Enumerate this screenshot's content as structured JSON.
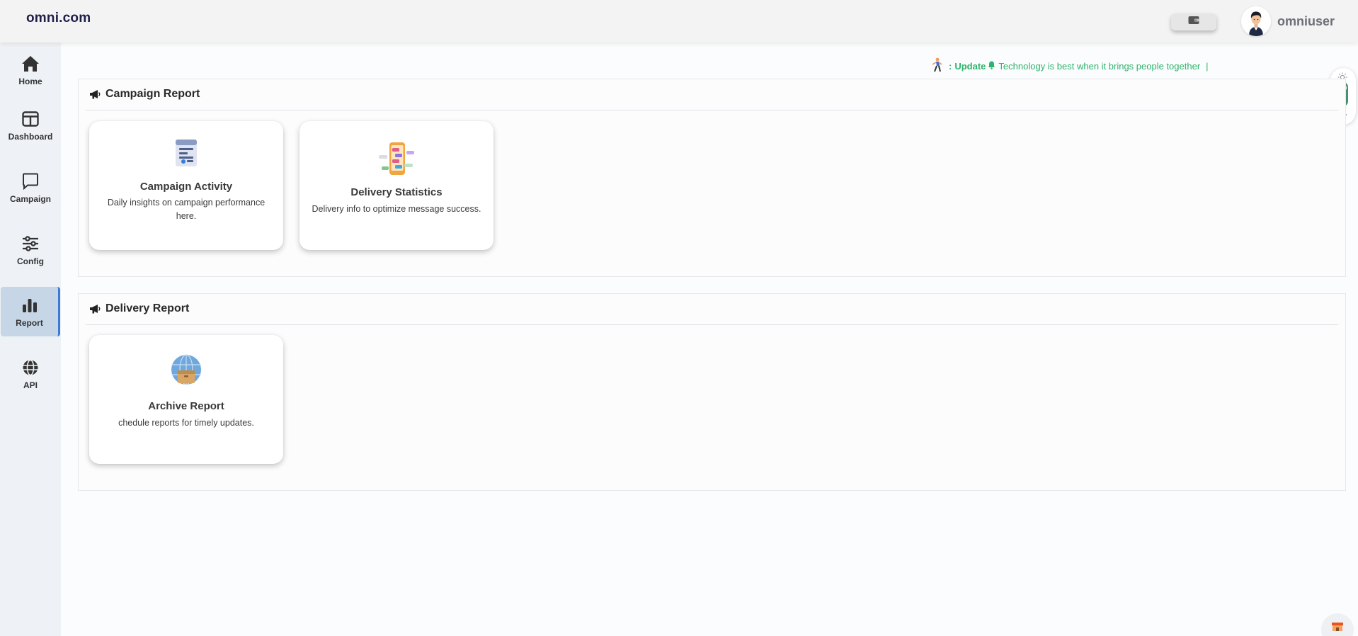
{
  "header": {
    "brand": "omni.com",
    "username": "omniuser"
  },
  "sidebar": {
    "items": [
      {
        "label": "Home",
        "icon": "home-icon"
      },
      {
        "label": "Dashboard",
        "icon": "dashboard-icon"
      },
      {
        "label": "Campaign",
        "icon": "chat-icon"
      },
      {
        "label": "Config",
        "icon": "sliders-icon"
      },
      {
        "label": "Report",
        "icon": "bar-chart-icon",
        "active": true
      },
      {
        "label": "API",
        "icon": "globe-icon"
      }
    ]
  },
  "ticker": {
    "prefix": ":",
    "update_label": "Update",
    "message": "Technology is best when it brings people together",
    "cursor": "|"
  },
  "panels": [
    {
      "title": "Campaign Report",
      "cards": [
        {
          "title": "Campaign Activity",
          "desc": "Daily insights on campaign performance here."
        },
        {
          "title": "Delivery Statistics",
          "desc": "Delivery info to optimize message success."
        }
      ]
    },
    {
      "title": "Delivery Report",
      "cards": [
        {
          "title": "Archive Report",
          "desc": "chedule reports for timely updates."
        }
      ]
    }
  ],
  "colors": {
    "accent_green": "#2fb36c",
    "active_nav_bg": "#c7d6e6",
    "active_nav_border": "#3b7bd6",
    "toggle_green": "#4a8f6f"
  }
}
